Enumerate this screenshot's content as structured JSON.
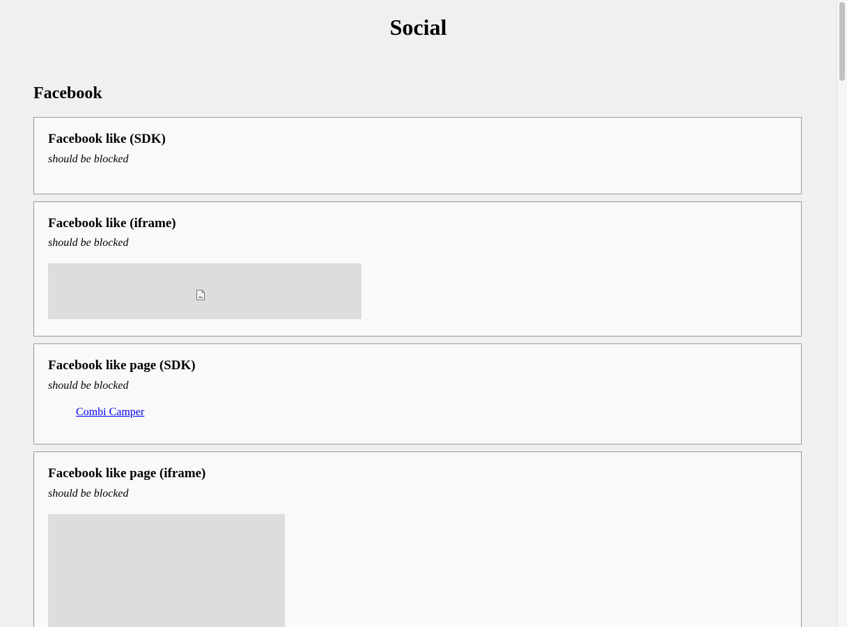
{
  "page": {
    "title": "Social"
  },
  "sections": {
    "facebook": {
      "title": "Facebook",
      "cards": [
        {
          "title": "Facebook like (SDK)",
          "note": "should be blocked"
        },
        {
          "title": "Facebook like (iframe)",
          "note": "should be blocked",
          "frame_icon": "broken-image-icon"
        },
        {
          "title": "Facebook like page (SDK)",
          "note": "should be blocked",
          "link_text": "Combi Camper"
        },
        {
          "title": "Facebook like page (iframe)",
          "note": "should be blocked"
        }
      ]
    }
  },
  "colors": {
    "page_background": "#f0f0f0",
    "card_background": "#f9f9f9",
    "card_border": "#999999",
    "placeholder": "#dddddd",
    "link": "#0000ee"
  }
}
